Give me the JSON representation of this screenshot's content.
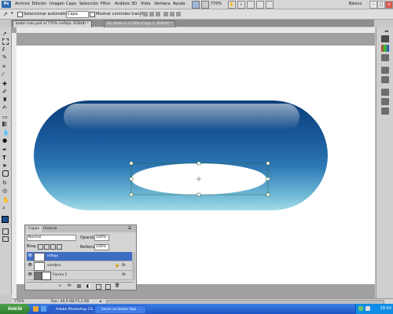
{
  "menubar": {
    "logo": "Ps",
    "items": [
      "Archivo",
      "Edición",
      "Imagen",
      "Capa",
      "Selección",
      "Filtro",
      "Análisis",
      "3D",
      "Vista",
      "Ventana",
      "Ayuda"
    ],
    "zoom": "770%",
    "workspace": "Básico"
  },
  "options": {
    "auto_select_label": "Seleccionar automáticamente:",
    "auto_select_value": "Capa",
    "show_transform_label": "Mostrar controles transf."
  },
  "tabs": [
    {
      "label": "boton mas.psd al 770% (reflejo, RGB/8) *",
      "active": true
    },
    {
      "label": "Sin título-1 al 50% (Capa 1, RGB/8) *",
      "active": false
    }
  ],
  "layers_panel": {
    "tabs": [
      "Capas",
      "Historia"
    ],
    "blend_mode": "Normal",
    "opacity_label": "Opacidad:",
    "opacity_value": "100%",
    "lock_label": "Bloq.:",
    "fill_label": "Relleno:",
    "fill_value": "100%",
    "layers": [
      {
        "name": "reflejo",
        "selected": true,
        "fx": false
      },
      {
        "name": "sombra",
        "selected": false,
        "fx": true
      },
      {
        "name": "Forma 1",
        "selected": false,
        "fx": true
      }
    ]
  },
  "status": {
    "zoom": "770%",
    "doc": "Doc: 40,9 KB/73,2 KB"
  },
  "taskbar": {
    "start": "Inicio",
    "items": [
      "Adobe Photoshop CS...",
      "hacer un boton tipo ..."
    ],
    "clock": "19:50"
  },
  "colors": {
    "button_dark": "#1a4f8f",
    "button_light": "#8fd0e0",
    "selection": "#3d6cc2"
  }
}
